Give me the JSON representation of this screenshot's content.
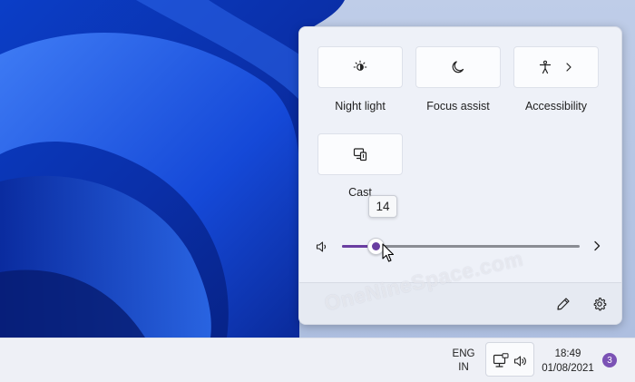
{
  "quick_settings": {
    "tiles": [
      {
        "label": "Night light",
        "icon": "night-light-icon"
      },
      {
        "label": "Focus assist",
        "icon": "moon-icon"
      },
      {
        "label": "Accessibility",
        "icon": "accessibility-icon",
        "has_chevron": true
      },
      {
        "label": "Cast",
        "icon": "cast-icon"
      }
    ],
    "volume": {
      "value": 14,
      "max": 100,
      "tooltip": "14",
      "accent_color": "#6a3ea1"
    },
    "footer": {
      "edit_icon": "pencil-icon",
      "settings_icon": "gear-icon"
    }
  },
  "watermark": "OneNineSpace.com",
  "taskbar": {
    "language": {
      "line1": "ENG",
      "line2": "IN"
    },
    "tray_icons": [
      "network-icon",
      "speaker-icon"
    ],
    "clock": {
      "time": "18:49",
      "date": "01/08/2021"
    },
    "notification_count": "3",
    "notification_color": "#7b52b5"
  }
}
